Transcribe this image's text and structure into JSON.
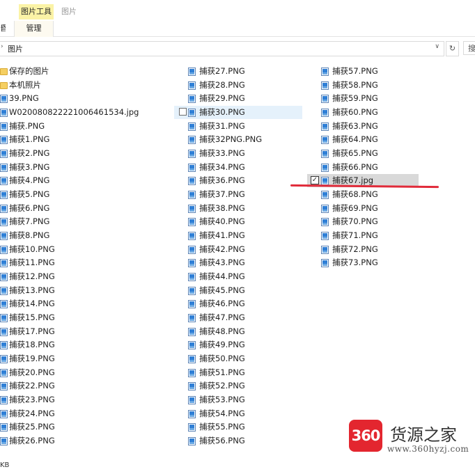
{
  "ribbon": {
    "tool_tab": "图片工具",
    "pic_tab": "图片",
    "manage_tab": "管理",
    "left_fragment": "昏"
  },
  "address": {
    "path": "图片",
    "refresh_icon": "refresh-icon",
    "search_fragment": "搜"
  },
  "columns": [
    {
      "items": [
        {
          "name": "保存的图片",
          "type": "folder"
        },
        {
          "name": "本机照片",
          "type": "folder"
        },
        {
          "name": "39.PNG",
          "type": "image"
        },
        {
          "name": "W020080822221006461534.jpg",
          "type": "image"
        },
        {
          "name": "捕获.PNG",
          "type": "image"
        },
        {
          "name": "捕获1.PNG",
          "type": "image"
        },
        {
          "name": "捕获2.PNG",
          "type": "image"
        },
        {
          "name": "捕获3.PNG",
          "type": "image"
        },
        {
          "name": "捕获4.PNG",
          "type": "image"
        },
        {
          "name": "捕获5.PNG",
          "type": "image"
        },
        {
          "name": "捕获6.PNG",
          "type": "image"
        },
        {
          "name": "捕获7.PNG",
          "type": "image"
        },
        {
          "name": "捕获8.PNG",
          "type": "image"
        },
        {
          "name": "捕获10.PNG",
          "type": "image"
        },
        {
          "name": "捕获11.PNG",
          "type": "image"
        },
        {
          "name": "捕获12.PNG",
          "type": "image"
        },
        {
          "name": "捕获13.PNG",
          "type": "image"
        },
        {
          "name": "捕获14.PNG",
          "type": "image"
        },
        {
          "name": "捕获15.PNG",
          "type": "image"
        },
        {
          "name": "捕获17.PNG",
          "type": "image"
        },
        {
          "name": "捕获18.PNG",
          "type": "image"
        },
        {
          "name": "捕获19.PNG",
          "type": "image"
        },
        {
          "name": "捕获20.PNG",
          "type": "image"
        },
        {
          "name": "捕获22.PNG",
          "type": "image"
        },
        {
          "name": "捕获23.PNG",
          "type": "image"
        },
        {
          "name": "捕获24.PNG",
          "type": "image"
        },
        {
          "name": "捕获25.PNG",
          "type": "image"
        },
        {
          "name": "捕获26.PNG",
          "type": "image"
        }
      ]
    },
    {
      "items": [
        {
          "name": "捕获27.PNG",
          "type": "image"
        },
        {
          "name": "捕获28.PNG",
          "type": "image"
        },
        {
          "name": "捕获29.PNG",
          "type": "image"
        },
        {
          "name": "捕获30.PNG",
          "type": "image",
          "hovered": true
        },
        {
          "name": "捕获31.PNG",
          "type": "image"
        },
        {
          "name": "捕获32PNG.PNG",
          "type": "image"
        },
        {
          "name": "捕获33.PNG",
          "type": "image"
        },
        {
          "name": "捕获34.PNG",
          "type": "image"
        },
        {
          "name": "捕获36.PNG",
          "type": "image"
        },
        {
          "name": "捕获37.PNG",
          "type": "image"
        },
        {
          "name": "捕获38.PNG",
          "type": "image"
        },
        {
          "name": "捕获40.PNG",
          "type": "image"
        },
        {
          "name": "捕获41.PNG",
          "type": "image"
        },
        {
          "name": "捕获42.PNG",
          "type": "image"
        },
        {
          "name": "捕获43.PNG",
          "type": "image"
        },
        {
          "name": "捕获44.PNG",
          "type": "image"
        },
        {
          "name": "捕获45.PNG",
          "type": "image"
        },
        {
          "name": "捕获46.PNG",
          "type": "image"
        },
        {
          "name": "捕获47.PNG",
          "type": "image"
        },
        {
          "name": "捕获48.PNG",
          "type": "image"
        },
        {
          "name": "捕获49.PNG",
          "type": "image"
        },
        {
          "name": "捕获50.PNG",
          "type": "image"
        },
        {
          "name": "捕获51.PNG",
          "type": "image"
        },
        {
          "name": "捕获52.PNG",
          "type": "image"
        },
        {
          "name": "捕获53.PNG",
          "type": "image"
        },
        {
          "name": "捕获54.PNG",
          "type": "image"
        },
        {
          "name": "捕获55.PNG",
          "type": "image"
        },
        {
          "name": "捕获56.PNG",
          "type": "image"
        }
      ]
    },
    {
      "items": [
        {
          "name": "捕获57.PNG",
          "type": "image"
        },
        {
          "name": "捕获58.PNG",
          "type": "image"
        },
        {
          "name": "捕获59.PNG",
          "type": "image"
        },
        {
          "name": "捕获60.PNG",
          "type": "image"
        },
        {
          "name": "捕获63.PNG",
          "type": "image"
        },
        {
          "name": "捕获64.PNG",
          "type": "image"
        },
        {
          "name": "捕获65.PNG",
          "type": "image"
        },
        {
          "name": "捕获66.PNG",
          "type": "image"
        },
        {
          "name": "捕获67.jpg",
          "type": "image",
          "selected": true
        },
        {
          "name": "捕获68.PNG",
          "type": "image"
        },
        {
          "name": "捕获69.PNG",
          "type": "image"
        },
        {
          "name": "捕获70.PNG",
          "type": "image"
        },
        {
          "name": "捕获71.PNG",
          "type": "image"
        },
        {
          "name": "捕获72.PNG",
          "type": "image"
        },
        {
          "name": "捕获73.PNG",
          "type": "image"
        }
      ]
    }
  ],
  "status": {
    "size_fragment": "KB"
  },
  "watermark": {
    "badge": "360",
    "title": "货源之家",
    "url": "www.360hyzj.com"
  },
  "colors": {
    "tool_tab_bg": "#fbf3a6",
    "hover_bg": "#e5f1fb",
    "selected_bg": "#d9d9d9",
    "annotation_red": "#e12b3a",
    "watermark_red": "#e3262f"
  }
}
